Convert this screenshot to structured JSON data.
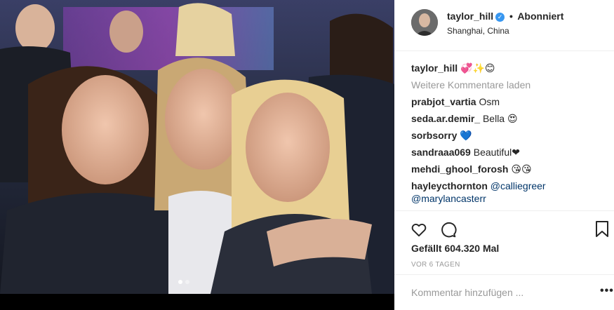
{
  "post": {
    "carousel_total": 2,
    "carousel_active": 1
  },
  "header": {
    "username": "taylor_hill",
    "verified_icon": "verified-badge-icon",
    "separator": "•",
    "follow_status": "Abonniert",
    "location": "Shanghai, China"
  },
  "caption": {
    "username": "taylor_hill",
    "text": "💞✨😊"
  },
  "load_more": "Weitere Kommentare laden",
  "comments": [
    {
      "user": "prabjot_vartia",
      "text": "Osm"
    },
    {
      "user": "seda.ar.demir_",
      "text": "Bella 😍"
    },
    {
      "user": "sorbsorry",
      "text": "💙"
    },
    {
      "user": "sandraaa069",
      "text": "Beautiful❤"
    },
    {
      "user": "mehdi_ghool_forosh",
      "text": "😘😘"
    },
    {
      "user": "hayleycthornton",
      "text": "@calliegreer @marylancasterr"
    }
  ],
  "actions": {
    "like_icon": "heart-outline-icon",
    "comment_icon": "comment-bubble-icon",
    "save_icon": "bookmark-icon"
  },
  "likes": "Gefällt 604.320 Mal",
  "time_ago": "VOR 6 TAGEN",
  "add_comment_placeholder": "Kommentar hinzufügen ...",
  "more_options": "•••",
  "colors": {
    "link": "#003569",
    "verified": "#3897f0",
    "muted": "#999999",
    "text": "#262626"
  }
}
